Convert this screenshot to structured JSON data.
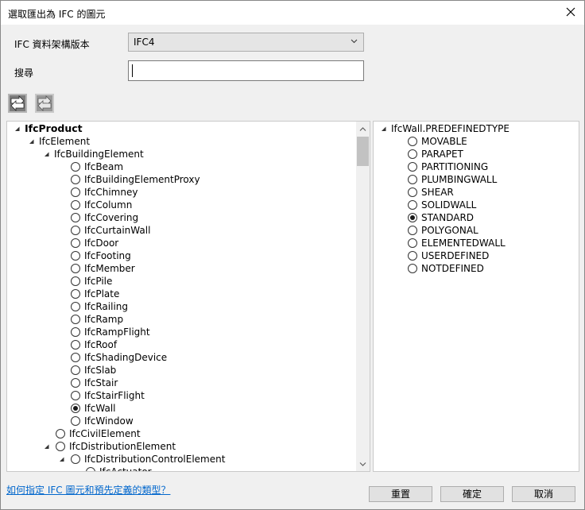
{
  "window": {
    "title": "選取匯出為 IFC 的圖元"
  },
  "schema": {
    "label": "IFC 資料架構版本",
    "value": "IFC4"
  },
  "search": {
    "label": "搜尋",
    "value": ""
  },
  "toolbar": {
    "expand_icon": "expand-all-icon",
    "collapse_icon": "collapse-all-icon"
  },
  "tree": {
    "root": "IfcProduct",
    "element": "IfcElement",
    "building_element": "IfcBuildingElement",
    "building_children": [
      "IfcBeam",
      "IfcBuildingElementProxy",
      "IfcChimney",
      "IfcColumn",
      "IfcCovering",
      "IfcCurtainWall",
      "IfcDoor",
      "IfcFooting",
      "IfcMember",
      "IfcPile",
      "IfcPlate",
      "IfcRailing",
      "IfcRamp",
      "IfcRampFlight",
      "IfcRoof",
      "IfcShadingDevice",
      "IfcSlab",
      "IfcStair",
      "IfcStairFlight",
      "IfcWall",
      "IfcWindow"
    ],
    "selected_item": "IfcWall",
    "civil_element": "IfcCivilElement",
    "distribution_element": "IfcDistributionElement",
    "distribution_control_element": "IfcDistributionControlElement",
    "partial_item": "IfcActuator"
  },
  "types": {
    "header": "IfcWall.PREDEFINEDTYPE",
    "options": [
      "MOVABLE",
      "PARAPET",
      "PARTITIONING",
      "PLUMBINGWALL",
      "SHEAR",
      "SOLIDWALL",
      "STANDARD",
      "POLYGONAL",
      "ELEMENTEDWALL",
      "USERDEFINED",
      "NOTDEFINED"
    ],
    "selected": "STANDARD"
  },
  "footer": {
    "help_link": "如何指定 IFC 圖元和預先定義的類型？",
    "reset": "重置",
    "ok": "確定",
    "cancel": "取消"
  }
}
